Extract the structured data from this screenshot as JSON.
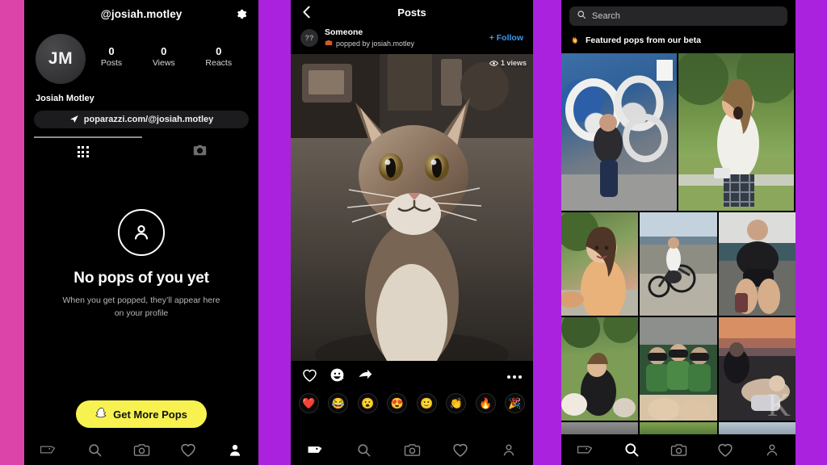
{
  "colors": {
    "band_pink": "#DD44AA",
    "band_purple": "#AA22DD",
    "phone_bg": "#000000",
    "cta_yellow": "#F7F24F",
    "follow_blue": "#3B9BF0"
  },
  "left_phone": {
    "header": {
      "handle": "@josiah.motley",
      "settings_icon": "gear-icon"
    },
    "profile": {
      "avatar_initials": "JM",
      "display_name": "Josiah Motley",
      "link_label": "poparazzi.com/@josiah.motley",
      "link_icon": "share-arrow-icon",
      "stats": [
        {
          "value": "0",
          "label": "Posts"
        },
        {
          "value": "0",
          "label": "Views"
        },
        {
          "value": "0",
          "label": "Reacts"
        }
      ]
    },
    "tabs": [
      {
        "name": "grid-tab",
        "icon": "grid-icon",
        "active": true
      },
      {
        "name": "camera-tab",
        "icon": "camera-icon",
        "active": false
      }
    ],
    "empty_state": {
      "icon": "person-circle-icon",
      "title": "No pops of you yet",
      "subtitle": "When you get popped, they’ll appear here on your profile"
    },
    "cta": {
      "label": "Get More Pops",
      "icon": "snapchat-ghost-icon"
    },
    "nav": [
      {
        "name": "home",
        "icon": "poparazzi-flag-icon",
        "active": false
      },
      {
        "name": "search",
        "icon": "search-icon",
        "active": false
      },
      {
        "name": "camera",
        "icon": "camera-icon",
        "active": false
      },
      {
        "name": "activity",
        "icon": "heart-icon",
        "active": false
      },
      {
        "name": "profile",
        "icon": "person-icon",
        "active": true
      }
    ]
  },
  "mid_phone": {
    "header": {
      "title": "Posts",
      "back_icon": "chevron-left-icon"
    },
    "post": {
      "avatar_text": "??",
      "author": "Someone",
      "subtitle": "popped by josiah.motley",
      "subtitle_icon": "camera-badge-icon",
      "follow_label": "+ Follow",
      "views_text": "1 views",
      "views_icon": "eye-icon",
      "photo_alt": "cat-photo"
    },
    "actions": [
      {
        "name": "like",
        "icon": "heart-outline-icon"
      },
      {
        "name": "react",
        "icon": "smiley-plus-icon"
      },
      {
        "name": "share",
        "icon": "share-arrow-icon"
      },
      {
        "name": "more",
        "icon": "ellipsis-icon"
      }
    ],
    "reactions": [
      "❤️",
      "😂",
      "😮",
      "😍",
      "🙂",
      "👏",
      "🔥",
      "🎉"
    ],
    "nav": [
      {
        "name": "home",
        "icon": "poparazzi-flag-icon",
        "active": true
      },
      {
        "name": "search",
        "icon": "search-icon",
        "active": false
      },
      {
        "name": "camera",
        "icon": "camera-icon",
        "active": false
      },
      {
        "name": "activity",
        "icon": "heart-icon",
        "active": false
      },
      {
        "name": "profile",
        "icon": "person-icon",
        "active": false
      }
    ]
  },
  "right_phone": {
    "search": {
      "placeholder": "Search",
      "icon": "search-icon"
    },
    "section": {
      "icon": "fire-icon",
      "label": "Featured pops from our beta"
    },
    "grid": [
      [
        {
          "name": "tile-graffiti",
          "style": "ph-graffiti"
        },
        {
          "name": "tile-park-girl",
          "style": "ph-park"
        }
      ],
      [
        {
          "name": "tile-selfie",
          "style": "ph-selfie"
        },
        {
          "name": "tile-beach-bike",
          "style": "ph-beach"
        },
        {
          "name": "tile-boat",
          "style": "ph-boat"
        }
      ],
      [
        {
          "name": "tile-grass-friends",
          "style": "ph-grass"
        },
        {
          "name": "tile-team",
          "style": "ph-team"
        },
        {
          "name": "tile-sunset",
          "style": "ph-sunset"
        }
      ],
      [
        {
          "name": "tile-sign",
          "style": "ph-sign"
        },
        {
          "name": "tile-leaf",
          "style": "ph-leaf"
        },
        {
          "name": "tile-city",
          "style": "ph-city"
        }
      ]
    ],
    "watermark": "K",
    "nav": [
      {
        "name": "home",
        "icon": "poparazzi-flag-icon",
        "active": false
      },
      {
        "name": "search",
        "icon": "search-icon",
        "active": true
      },
      {
        "name": "camera",
        "icon": "camera-icon",
        "active": false
      },
      {
        "name": "activity",
        "icon": "heart-icon",
        "active": false
      },
      {
        "name": "profile",
        "icon": "person-icon",
        "active": false
      }
    ]
  }
}
